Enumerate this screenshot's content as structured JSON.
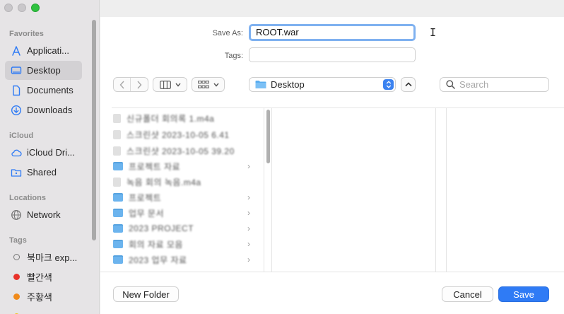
{
  "sidebar": {
    "sections": [
      {
        "title": "Favorites",
        "items": [
          {
            "label": "Applicati...",
            "icon": "applications-icon",
            "selected": false
          },
          {
            "label": "Desktop",
            "icon": "desktop-icon",
            "selected": true
          },
          {
            "label": "Documents",
            "icon": "documents-icon",
            "selected": false
          },
          {
            "label": "Downloads",
            "icon": "downloads-icon",
            "selected": false
          }
        ]
      },
      {
        "title": "iCloud",
        "items": [
          {
            "label": "iCloud Dri...",
            "icon": "icloud-icon"
          },
          {
            "label": "Shared",
            "icon": "shared-folder-icon"
          }
        ]
      },
      {
        "title": "Locations",
        "items": [
          {
            "label": "Network",
            "icon": "network-globe-icon"
          }
        ]
      },
      {
        "title": "Tags",
        "items": [
          {
            "label": "북마크 exp...",
            "color": "hollow"
          },
          {
            "label": "빨간색",
            "color": "#e8322a"
          },
          {
            "label": "주황색",
            "color": "#f08a1b"
          }
        ]
      }
    ]
  },
  "form": {
    "save_as_label": "Save As:",
    "save_as_value": "ROOT.war",
    "tags_label": "Tags:",
    "tags_value": ""
  },
  "toolbar": {
    "location": "Desktop",
    "search_placeholder": "Search"
  },
  "files": [
    {
      "name": "신규폴더 회의록 1.m4a",
      "type": "file",
      "chevron": false
    },
    {
      "name": "스크린샷 2023-10-05 6.41",
      "type": "file",
      "chevron": false
    },
    {
      "name": "스크린샷 2023-10-05 39.20",
      "type": "file",
      "chevron": false
    },
    {
      "name": "프로젝트 자료",
      "type": "folder",
      "chevron": true
    },
    {
      "name": "녹음 회의 녹음.m4a",
      "type": "file",
      "chevron": false
    },
    {
      "name": "프로젝트",
      "type": "folder",
      "chevron": true
    },
    {
      "name": "업무 문서",
      "type": "folder",
      "chevron": true
    },
    {
      "name": "2023 PROJECT",
      "type": "folder",
      "chevron": true
    },
    {
      "name": "회의 자료 모음",
      "type": "folder",
      "chevron": true
    },
    {
      "name": "2023 업무 자료",
      "type": "folder",
      "chevron": true
    }
  ],
  "buttons": {
    "new_folder": "New Folder",
    "cancel": "Cancel",
    "save": "Save"
  }
}
